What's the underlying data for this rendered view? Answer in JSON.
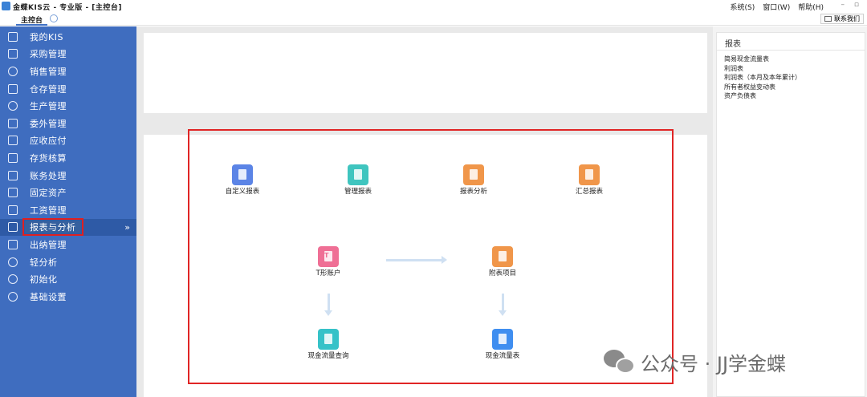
{
  "window": {
    "title": "金蝶KIS云 - 专业版 - [主控台]",
    "menus": [
      "系统(S)",
      "窗口(W)",
      "帮助(H)"
    ],
    "min_glyph": "–",
    "restore_glyph": "▫"
  },
  "tabs": {
    "active_label": "主控台",
    "contact_label": "联系我们"
  },
  "sidebar": {
    "items": [
      {
        "label": "我的KIS",
        "icon": "monitor-icon"
      },
      {
        "label": "采购管理",
        "icon": "purchase-icon"
      },
      {
        "label": "销售管理",
        "icon": "people-icon"
      },
      {
        "label": "仓存管理",
        "icon": "warehouse-icon"
      },
      {
        "label": "生产管理",
        "icon": "gear-icon"
      },
      {
        "label": "委外管理",
        "icon": "outsource-icon"
      },
      {
        "label": "应收应付",
        "icon": "yen-icon"
      },
      {
        "label": "存货核算",
        "icon": "inventory-icon"
      },
      {
        "label": "账务处理",
        "icon": "ledger-icon"
      },
      {
        "label": "固定资产",
        "icon": "building-icon"
      },
      {
        "label": "工资管理",
        "icon": "salary-icon"
      },
      {
        "label": "报表与分析",
        "icon": "chart-icon"
      },
      {
        "label": "出纳管理",
        "icon": "cashier-icon"
      },
      {
        "label": "轻分析",
        "icon": "magnifier-icon"
      },
      {
        "label": "初始化",
        "icon": "init-icon"
      },
      {
        "label": "基础设置",
        "icon": "settings-icon"
      }
    ],
    "active_chevron": "»"
  },
  "flow": {
    "custom_report": "自定义报表",
    "management_report": "管理报表",
    "report_analysis": "报表分析",
    "summary_report": "汇总报表",
    "t_account": "T形账户",
    "t_account_glyph": "T",
    "attached_items": "附表项目",
    "cashflow_query": "现金流量查询",
    "cashflow_statement": "现金流量表"
  },
  "right_panel": {
    "header": "报表",
    "links": [
      "简易现金流量表",
      "利润表",
      "利润表（本月及本年累计）",
      "所有者权益变动表",
      "资产负债表"
    ]
  },
  "watermark": "公众号 · JJ学金蝶",
  "colors": {
    "sidebar": "#3f6dbf",
    "highlight": "#e02525",
    "custom_report_icon": "#5b84e6",
    "management_report_icon": "#3fc5bf",
    "orange_icon": "#f0964a",
    "t_account_icon": "#ef6f95",
    "cashflow_query_icon": "#36c2c8",
    "cashflow_statement_icon": "#3f8ef0"
  }
}
